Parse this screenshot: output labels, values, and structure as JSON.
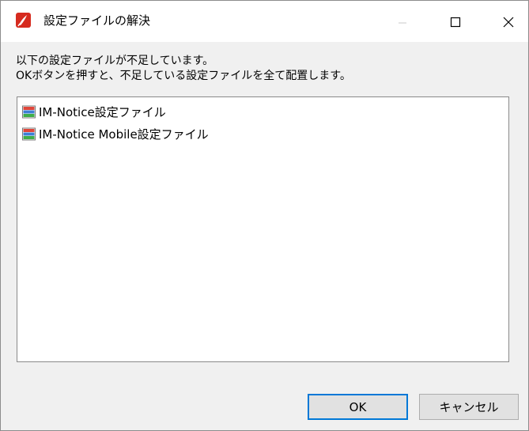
{
  "window": {
    "title": "設定ファイルの解決",
    "app_icon": "app-icon",
    "controls": {
      "minimize_icon": "minimize-icon",
      "maximize_icon": "maximize-icon",
      "close_icon": "close-icon"
    }
  },
  "message": {
    "line1": "以下の設定ファイルが不足しています。",
    "line2": "OKボタンを押すと、不足している設定ファイルを全て配置します。"
  },
  "list": {
    "items": [
      {
        "label": "IM-Notice設定ファイル",
        "icon": "settings-file-icon"
      },
      {
        "label": "IM-Notice Mobile設定ファイル",
        "icon": "settings-file-icon"
      }
    ]
  },
  "buttons": {
    "ok_label": "OK",
    "cancel_label": "キャンセル"
  },
  "colors": {
    "titlebar": "#ffffff",
    "window_bg": "#f0f0f0",
    "app_icon": "#d62b1f",
    "default_button_border": "#0078d7",
    "icon_stripe_red": "#e0463a",
    "icon_stripe_blue": "#3d7fd6",
    "icon_stripe_green": "#3fae49"
  }
}
